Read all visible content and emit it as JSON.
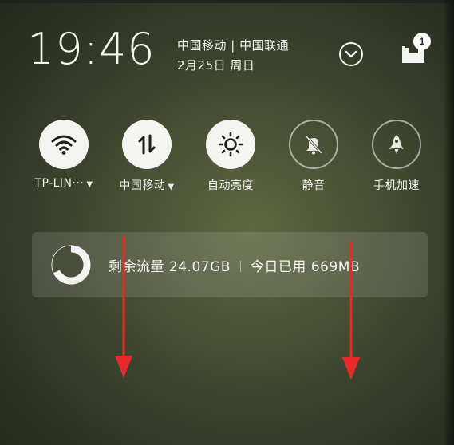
{
  "status": {
    "time": "19:46",
    "carriers": "中国移动 | 中国联通",
    "date": "2月25日 周日",
    "inbox_badge": "1"
  },
  "toggles": [
    {
      "label": "TP-LIN···",
      "icon": "wifi-icon",
      "state": "on",
      "has_caret": true
    },
    {
      "label": "中国移动",
      "icon": "data-transfer-icon",
      "state": "on",
      "has_caret": true
    },
    {
      "label": "自动亮度",
      "icon": "brightness-icon",
      "state": "on",
      "has_caret": false
    },
    {
      "label": "静音",
      "icon": "mute-bell-icon",
      "state": "off",
      "has_caret": false
    },
    {
      "label": "手机加速",
      "icon": "rocket-icon",
      "state": "off",
      "has_caret": false
    }
  ],
  "data_usage": {
    "remaining_label": "剩余流量",
    "remaining_value": "24.07GB",
    "today_label": "今日已用",
    "today_value": "669MB"
  },
  "colors": {
    "accent_on": "#f4f4f0",
    "arrow": "#e8292b"
  }
}
